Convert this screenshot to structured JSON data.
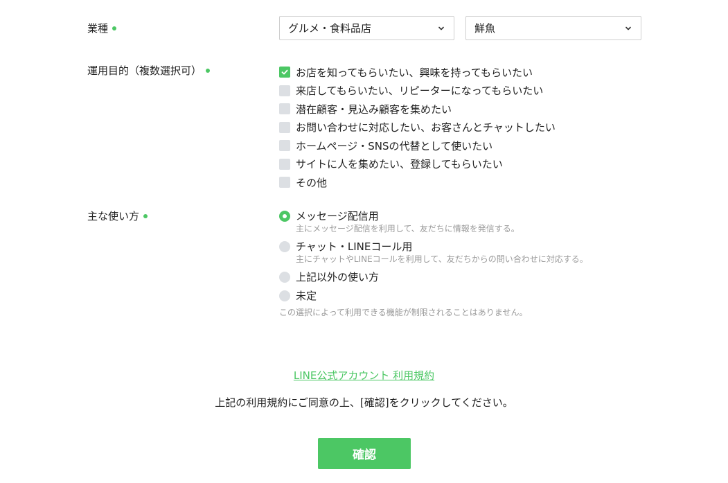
{
  "industry": {
    "label": "業種",
    "category_value": "グルメ・食料品店",
    "subcategory_value": "鮮魚"
  },
  "purpose": {
    "label": "運用目的（複数選択可）",
    "options": [
      {
        "label": "お店を知ってもらいたい、興味を持ってもらいたい",
        "checked": true
      },
      {
        "label": "来店してもらいたい、リピーターになってもらいたい",
        "checked": false
      },
      {
        "label": "潜在顧客・見込み顧客を集めたい",
        "checked": false
      },
      {
        "label": "お問い合わせに対応したい、お客さんとチャットしたい",
        "checked": false
      },
      {
        "label": "ホームページ・SNSの代替として使いたい",
        "checked": false
      },
      {
        "label": "サイトに人を集めたい、登録してもらいたい",
        "checked": false
      },
      {
        "label": "その他",
        "checked": false
      }
    ]
  },
  "usage": {
    "label": "主な使い方",
    "options": [
      {
        "label": "メッセージ配信用",
        "desc": "主にメッセージ配信を利用して、友だちに情報を発信する。",
        "checked": true
      },
      {
        "label": "チャット・LINEコール用",
        "desc": "主にチャットやLINEコールを利用して、友だちからの問い合わせに対応する。",
        "checked": false
      },
      {
        "label": "上記以外の使い方",
        "desc": "",
        "checked": false
      },
      {
        "label": "未定",
        "desc": "",
        "checked": false
      }
    ],
    "note": "この選択によって利用できる機能が制限されることはありません。"
  },
  "terms": {
    "link_label": "LINE公式アカウント 利用規約",
    "agree_text": "上記の利用規約にご同意の上、[確認]をクリックしてください。"
  },
  "confirm_label": "確認",
  "colors": {
    "accent": "#4cc764",
    "unchecked": "#dcdfe3"
  },
  "icons": {
    "select_chevron": "chevron-down-icon",
    "checkbox_check": "check-icon",
    "required_marker": "required-dot-icon"
  }
}
